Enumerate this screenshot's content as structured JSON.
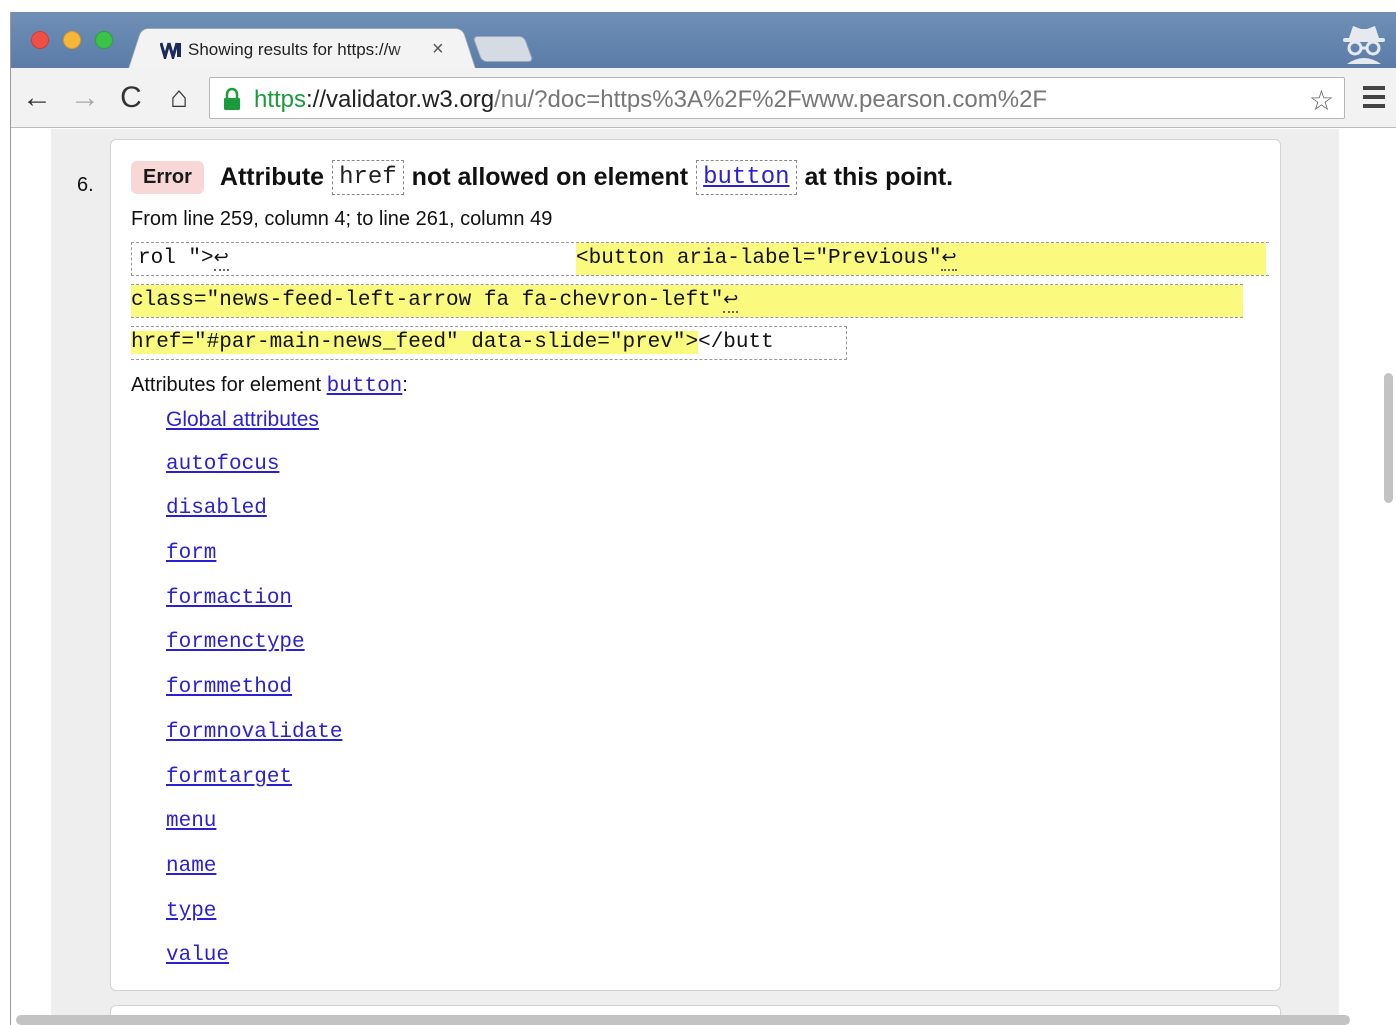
{
  "browser": {
    "tab": {
      "title": "Showing results for https://w",
      "close": "×"
    },
    "nav": {
      "back": "←",
      "forward": "→",
      "reload": "C",
      "home": "⌂"
    },
    "url": {
      "scheme": "https",
      "host": "://validator.w3.org",
      "path": "/nu/?doc=https%3A%2F%2Fwww.pearson.com%2F"
    },
    "star": "☆"
  },
  "message": {
    "number": "6.",
    "badge": "Error",
    "head_part1": "Attribute",
    "attr_code": "href",
    "head_part2": "not allowed on element",
    "element_code": "button",
    "head_part3": "at this point.",
    "location": "From line 259, column 4; to line 261, column 49",
    "extract": {
      "line1_lead": "rol \">",
      "line1_hl": "<button aria-label=\"Previous\"",
      "line2_hl": "class=\"news-feed-left-arrow fa fa-chevron-left\"",
      "line3_hl": "href=\"#par-main-news_feed\" data-slide=\"prev\">",
      "line3_tail": "</butt",
      "return_glyph": "↩"
    },
    "attributes_label": "Attributes for element",
    "attributes_element": "button",
    "attributes_colon": ":",
    "attributes": [
      "Global attributes",
      "autofocus",
      "disabled",
      "form",
      "formaction",
      "formenctype",
      "formmethod",
      "formnovalidate",
      "formtarget",
      "menu",
      "name",
      "type",
      "value"
    ]
  },
  "colors": {
    "error_badge_bg": "#f8d7d7",
    "highlight": "#fafb7e",
    "link": "#2a1fd1",
    "secure_scheme": "#1a9c3c"
  }
}
